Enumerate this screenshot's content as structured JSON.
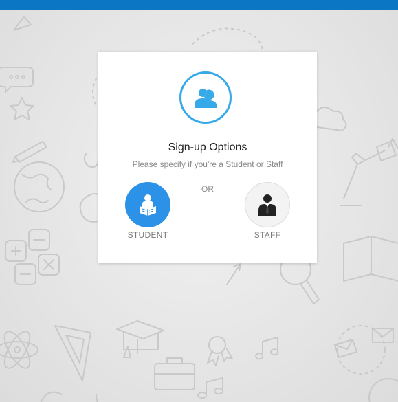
{
  "header": {
    "bar_color": "#0a76c4"
  },
  "signup_card": {
    "header_icon": "users-icon",
    "title": "Sign-up Options",
    "subtitle": "Please specify if you're a Student or Staff",
    "separator": "OR",
    "options": [
      {
        "label": "STUDENT",
        "icon": "student-reading-icon",
        "color": "#2b92e8"
      },
      {
        "label": "STAFF",
        "icon": "staff-businessman-icon",
        "color": "#f3f3f3"
      }
    ]
  },
  "colors": {
    "accent": "#36a9e8",
    "primary": "#2b92e8"
  }
}
